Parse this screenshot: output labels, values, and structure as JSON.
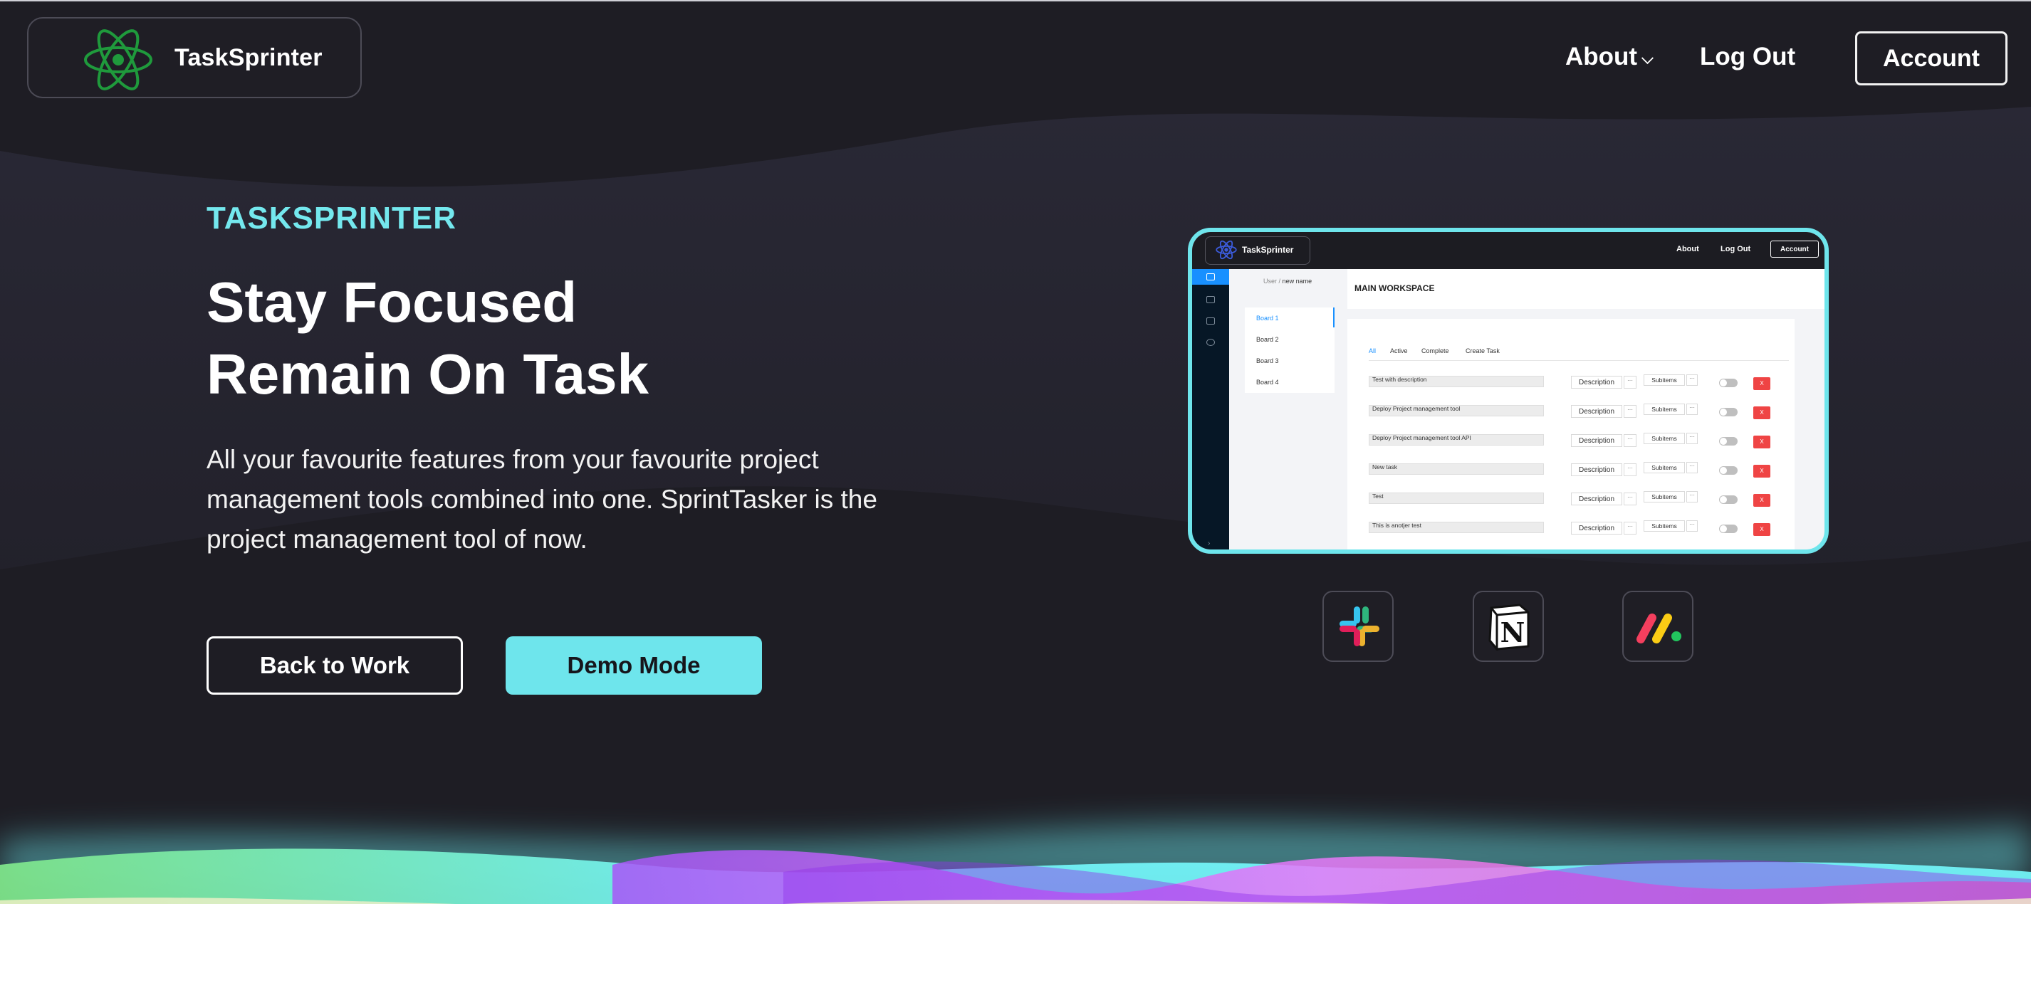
{
  "nav": {
    "brand": "TaskSprinter",
    "about_label": "About",
    "logout_label": "Log Out",
    "account_label": "Account"
  },
  "hero": {
    "eyebrow": "TASKSPRINTER",
    "headline_line1": "Stay Focused",
    "headline_line2": "Remain On Task",
    "description": "All your favourite features from your favourite project management tools combined into one. SprintTasker is the project management tool of now.",
    "primary_button": "Back to Work",
    "secondary_button": "Demo Mode"
  },
  "preview": {
    "brand": "TaskSprinter",
    "about_label": "About",
    "logout_label": "Log Out",
    "account_label": "Account",
    "breadcrumb_user": "User",
    "breadcrumb_sep": "/",
    "breadcrumb_name": "new name",
    "boards": [
      "Board 1",
      "Board 2",
      "Board 3",
      "Board 4"
    ],
    "workspace_title": "MAIN WORKSPACE",
    "tabs": [
      "All",
      "Active",
      "Complete",
      "Create Task"
    ],
    "tasks": [
      "Test with description",
      "Deploy Project management tool",
      "Deploy Project management tool API",
      "New task",
      "Test",
      "This is anotjer test"
    ],
    "description_label": "Description",
    "subitems_label": "Subitems",
    "more_label": "···",
    "delete_label": "X"
  },
  "integrations": [
    "slack-icon",
    "notion-icon",
    "monday-icon"
  ],
  "colors": {
    "background": "#1e1d24",
    "accent": "#6ee5ec",
    "logo_green": "#1f9a3c"
  }
}
